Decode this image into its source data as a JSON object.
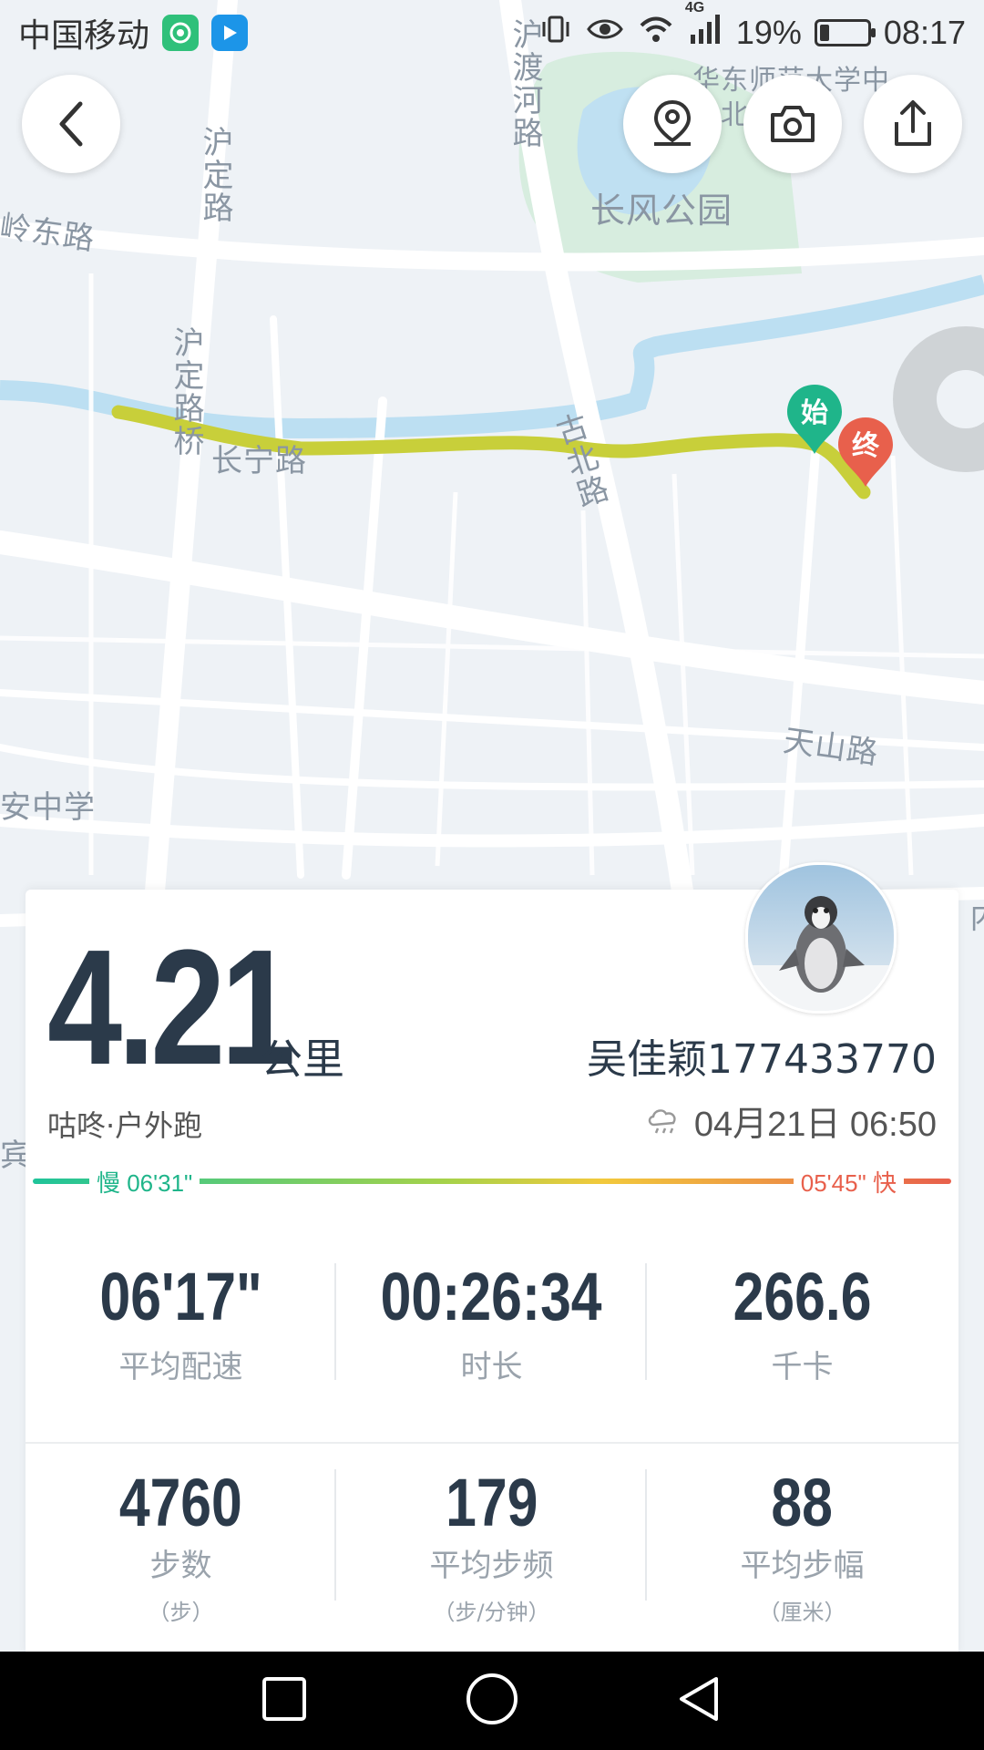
{
  "status_bar": {
    "carrier": "中国移动",
    "network": "4G",
    "battery": "19%",
    "time": "08:17"
  },
  "map": {
    "labels": {
      "road_hudu": "沪渡河路",
      "school": "华东师范大学中山北路校",
      "park": "长风公园",
      "road_lingdong": "岭东路",
      "road_huding": "沪定路",
      "road_huding_bridge": "沪定路桥",
      "road_changning": "长宁路",
      "road_gubei": "古北路",
      "road_tianshan": "天山路",
      "school_an": "安中学",
      "edge_right": "内",
      "edge_left": "宾"
    },
    "start_marker": "始",
    "end_marker": "终"
  },
  "summary": {
    "distance": "4.21",
    "distance_unit": "公里",
    "activity": "咕咚·户外跑",
    "username": "吴佳颖177433770",
    "datetime": "04月21日 06:50",
    "pace_slow": "慢 06'31\"",
    "pace_fast": "05'45\" 快"
  },
  "stats": {
    "row1": [
      {
        "value": "06'17\"",
        "label": "平均配速"
      },
      {
        "value": "00:26:34",
        "label": "时长"
      },
      {
        "value": "266.6",
        "label": "千卡"
      }
    ],
    "row2": [
      {
        "value": "4760",
        "label": "步数",
        "unit": "（步）"
      },
      {
        "value": "179",
        "label": "平均步频",
        "unit": "（步/分钟）"
      },
      {
        "value": "88",
        "label": "平均步幅",
        "unit": "（厘米）"
      }
    ]
  },
  "colors": {
    "route": "#c8cf3a",
    "start": "#1fb58a",
    "end": "#e8604c",
    "text_dark": "#2b3a4a"
  }
}
